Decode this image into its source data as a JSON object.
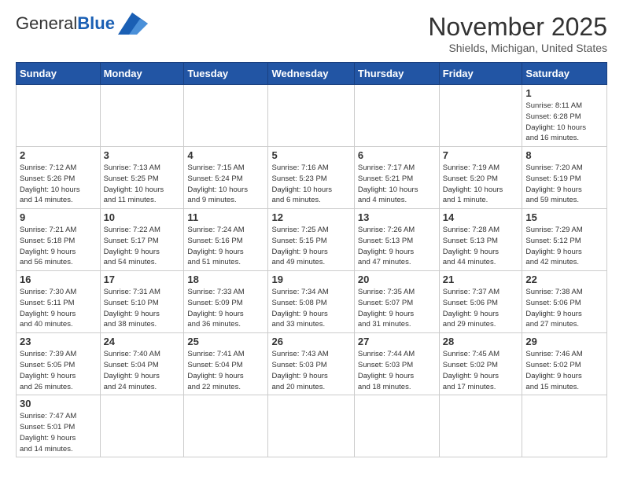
{
  "logo": {
    "text_general": "General",
    "text_blue": "Blue"
  },
  "header": {
    "month_year": "November 2025",
    "location": "Shields, Michigan, United States"
  },
  "weekdays": [
    "Sunday",
    "Monday",
    "Tuesday",
    "Wednesday",
    "Thursday",
    "Friday",
    "Saturday"
  ],
  "weeks": [
    [
      {
        "day": "",
        "info": ""
      },
      {
        "day": "",
        "info": ""
      },
      {
        "day": "",
        "info": ""
      },
      {
        "day": "",
        "info": ""
      },
      {
        "day": "",
        "info": ""
      },
      {
        "day": "",
        "info": ""
      },
      {
        "day": "1",
        "info": "Sunrise: 8:11 AM\nSunset: 6:28 PM\nDaylight: 10 hours\nand 16 minutes."
      }
    ],
    [
      {
        "day": "2",
        "info": "Sunrise: 7:12 AM\nSunset: 5:26 PM\nDaylight: 10 hours\nand 14 minutes."
      },
      {
        "day": "3",
        "info": "Sunrise: 7:13 AM\nSunset: 5:25 PM\nDaylight: 10 hours\nand 11 minutes."
      },
      {
        "day": "4",
        "info": "Sunrise: 7:15 AM\nSunset: 5:24 PM\nDaylight: 10 hours\nand 9 minutes."
      },
      {
        "day": "5",
        "info": "Sunrise: 7:16 AM\nSunset: 5:23 PM\nDaylight: 10 hours\nand 6 minutes."
      },
      {
        "day": "6",
        "info": "Sunrise: 7:17 AM\nSunset: 5:21 PM\nDaylight: 10 hours\nand 4 minutes."
      },
      {
        "day": "7",
        "info": "Sunrise: 7:19 AM\nSunset: 5:20 PM\nDaylight: 10 hours\nand 1 minute."
      },
      {
        "day": "8",
        "info": "Sunrise: 7:20 AM\nSunset: 5:19 PM\nDaylight: 9 hours\nand 59 minutes."
      }
    ],
    [
      {
        "day": "9",
        "info": "Sunrise: 7:21 AM\nSunset: 5:18 PM\nDaylight: 9 hours\nand 56 minutes."
      },
      {
        "day": "10",
        "info": "Sunrise: 7:22 AM\nSunset: 5:17 PM\nDaylight: 9 hours\nand 54 minutes."
      },
      {
        "day": "11",
        "info": "Sunrise: 7:24 AM\nSunset: 5:16 PM\nDaylight: 9 hours\nand 51 minutes."
      },
      {
        "day": "12",
        "info": "Sunrise: 7:25 AM\nSunset: 5:15 PM\nDaylight: 9 hours\nand 49 minutes."
      },
      {
        "day": "13",
        "info": "Sunrise: 7:26 AM\nSunset: 5:13 PM\nDaylight: 9 hours\nand 47 minutes."
      },
      {
        "day": "14",
        "info": "Sunrise: 7:28 AM\nSunset: 5:13 PM\nDaylight: 9 hours\nand 44 minutes."
      },
      {
        "day": "15",
        "info": "Sunrise: 7:29 AM\nSunset: 5:12 PM\nDaylight: 9 hours\nand 42 minutes."
      }
    ],
    [
      {
        "day": "16",
        "info": "Sunrise: 7:30 AM\nSunset: 5:11 PM\nDaylight: 9 hours\nand 40 minutes."
      },
      {
        "day": "17",
        "info": "Sunrise: 7:31 AM\nSunset: 5:10 PM\nDaylight: 9 hours\nand 38 minutes."
      },
      {
        "day": "18",
        "info": "Sunrise: 7:33 AM\nSunset: 5:09 PM\nDaylight: 9 hours\nand 36 minutes."
      },
      {
        "day": "19",
        "info": "Sunrise: 7:34 AM\nSunset: 5:08 PM\nDaylight: 9 hours\nand 33 minutes."
      },
      {
        "day": "20",
        "info": "Sunrise: 7:35 AM\nSunset: 5:07 PM\nDaylight: 9 hours\nand 31 minutes."
      },
      {
        "day": "21",
        "info": "Sunrise: 7:37 AM\nSunset: 5:06 PM\nDaylight: 9 hours\nand 29 minutes."
      },
      {
        "day": "22",
        "info": "Sunrise: 7:38 AM\nSunset: 5:06 PM\nDaylight: 9 hours\nand 27 minutes."
      }
    ],
    [
      {
        "day": "23",
        "info": "Sunrise: 7:39 AM\nSunset: 5:05 PM\nDaylight: 9 hours\nand 26 minutes."
      },
      {
        "day": "24",
        "info": "Sunrise: 7:40 AM\nSunset: 5:04 PM\nDaylight: 9 hours\nand 24 minutes."
      },
      {
        "day": "25",
        "info": "Sunrise: 7:41 AM\nSunset: 5:04 PM\nDaylight: 9 hours\nand 22 minutes."
      },
      {
        "day": "26",
        "info": "Sunrise: 7:43 AM\nSunset: 5:03 PM\nDaylight: 9 hours\nand 20 minutes."
      },
      {
        "day": "27",
        "info": "Sunrise: 7:44 AM\nSunset: 5:03 PM\nDaylight: 9 hours\nand 18 minutes."
      },
      {
        "day": "28",
        "info": "Sunrise: 7:45 AM\nSunset: 5:02 PM\nDaylight: 9 hours\nand 17 minutes."
      },
      {
        "day": "29",
        "info": "Sunrise: 7:46 AM\nSunset: 5:02 PM\nDaylight: 9 hours\nand 15 minutes."
      }
    ],
    [
      {
        "day": "30",
        "info": "Sunrise: 7:47 AM\nSunset: 5:01 PM\nDaylight: 9 hours\nand 14 minutes."
      },
      {
        "day": "",
        "info": ""
      },
      {
        "day": "",
        "info": ""
      },
      {
        "day": "",
        "info": ""
      },
      {
        "day": "",
        "info": ""
      },
      {
        "day": "",
        "info": ""
      },
      {
        "day": "",
        "info": ""
      }
    ]
  ]
}
